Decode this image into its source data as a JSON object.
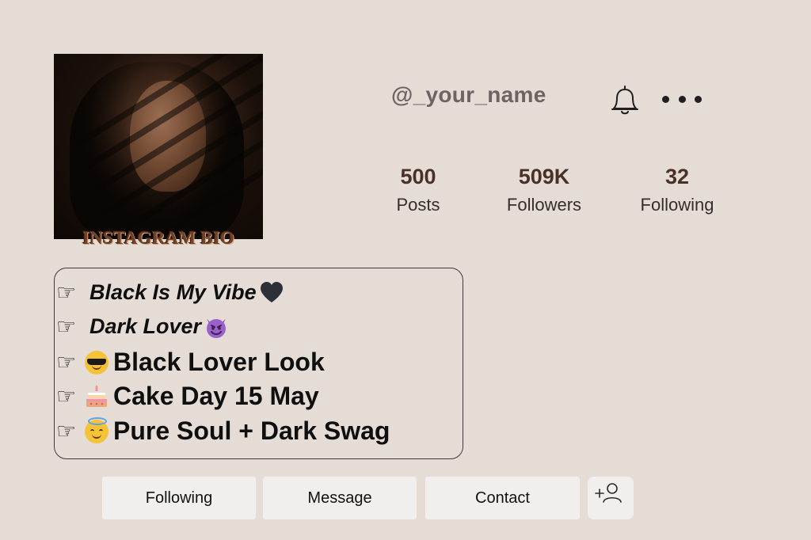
{
  "profile": {
    "username": "@_your_name",
    "photo_caption": "INSTAGRAM BIO"
  },
  "header": {
    "notification_icon": "bell-icon",
    "more_icon": "more-dots-icon"
  },
  "stats": [
    {
      "value": "500",
      "label": "Posts"
    },
    {
      "value": "509K",
      "label": "Followers"
    },
    {
      "value": "32",
      "label": "Following"
    }
  ],
  "bio": {
    "pointer_glyph": "☞",
    "lines": [
      {
        "text": "Black Is My Vibe",
        "emoji": "black-heart"
      },
      {
        "text": "Dark Lover",
        "emoji": "smiling-devil"
      },
      {
        "text": "Black Lover Look",
        "emoji": "sunglasses-face"
      },
      {
        "text": "Cake Day 15 May",
        "emoji": "birthday-cake"
      },
      {
        "text": "Pure Soul + Dark Swag",
        "emoji": "angel-face"
      }
    ]
  },
  "actions": {
    "following_label": "Following",
    "message_label": "Message",
    "contact_label": "Contact",
    "add_user_icon": "add-user-icon"
  },
  "colors": {
    "background": "#e5dcd6",
    "username": "#6b6462",
    "stat_number": "#4a3128",
    "button_bg": "#f0efee",
    "caption": "#6e4328"
  }
}
